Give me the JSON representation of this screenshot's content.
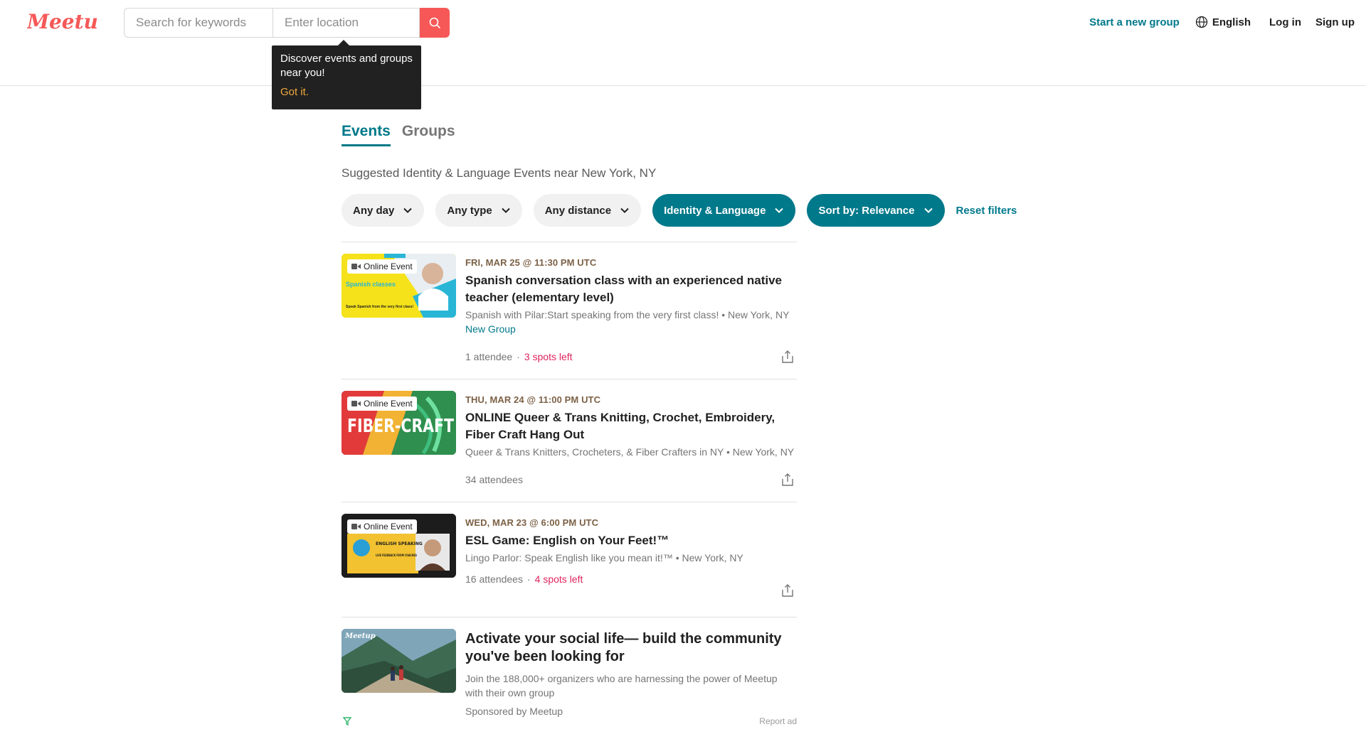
{
  "header": {
    "logo_text": "Meetup",
    "search": {
      "keywords_placeholder": "Search for keywords",
      "location_placeholder": "Enter location"
    },
    "tooltip": {
      "text": "Discover events and groups near you!",
      "action": "Got it."
    },
    "nav": {
      "start_group": "Start a new group",
      "language": "English",
      "login": "Log in",
      "signup": "Sign up"
    }
  },
  "tabs": [
    {
      "label": "Events",
      "active": true
    },
    {
      "label": "Groups",
      "active": false
    }
  ],
  "suggestion": "Suggested Identity & Language Events near New York, NY",
  "filters": {
    "day": "Any day",
    "type": "Any type",
    "distance": "Any distance",
    "category": "Identity & Language",
    "sort": "Sort by: Relevance",
    "reset": "Reset filters"
  },
  "events": [
    {
      "badge": "Online Event",
      "date": "FRI, MAR 25 @ 11:30 PM UTC",
      "title": "Spanish conversation class with an experienced native teacher (elementary level)",
      "group": "Spanish with Pilar:Start speaking from the very first class! • New York, NY",
      "new_group": "New Group",
      "attendees": "1 attendee",
      "spots": "3 spots left",
      "image_text": "Spanish classes",
      "image_sub": "Speak Spanish from the very first class!"
    },
    {
      "badge": "Online Event",
      "date": "THU, MAR 24 @ 11:00 PM UTC",
      "title": "ONLINE Queer & Trans Knitting, Crochet, Embroidery, Fiber Craft Hang Out",
      "group": "Queer & Trans Knitters, Crocheters, & Fiber Crafters in NY • New York, NY",
      "attendees": "34 attendees",
      "image_text": "FIBER-CRAFT"
    },
    {
      "badge": "Online Event",
      "date": "WED, MAR 23 @ 6:00 PM UTC",
      "title": "ESL Game: English on Your Feet!™",
      "group": "Lingo Parlor: Speak English like you mean it!™ • New York, NY",
      "attendees": "16 attendees",
      "spots": "4 spots left",
      "image_text": "ENGLISH SPEAKING",
      "image_sub": "LIVE FEEDBACK FROM COACHES"
    }
  ],
  "ad": {
    "title": "Activate your social life— build the community you've been looking for",
    "text": "Join the 188,000+ organizers who are harnessing the power of Meetup with their own group",
    "sponsor": "Sponsored by Meetup",
    "report": "Report ad",
    "image_logo": "Meetup"
  },
  "colors": {
    "brand_red": "#f65858",
    "teal": "#00798a",
    "spots_red": "#e0245e",
    "date_brown": "#7c6146"
  }
}
